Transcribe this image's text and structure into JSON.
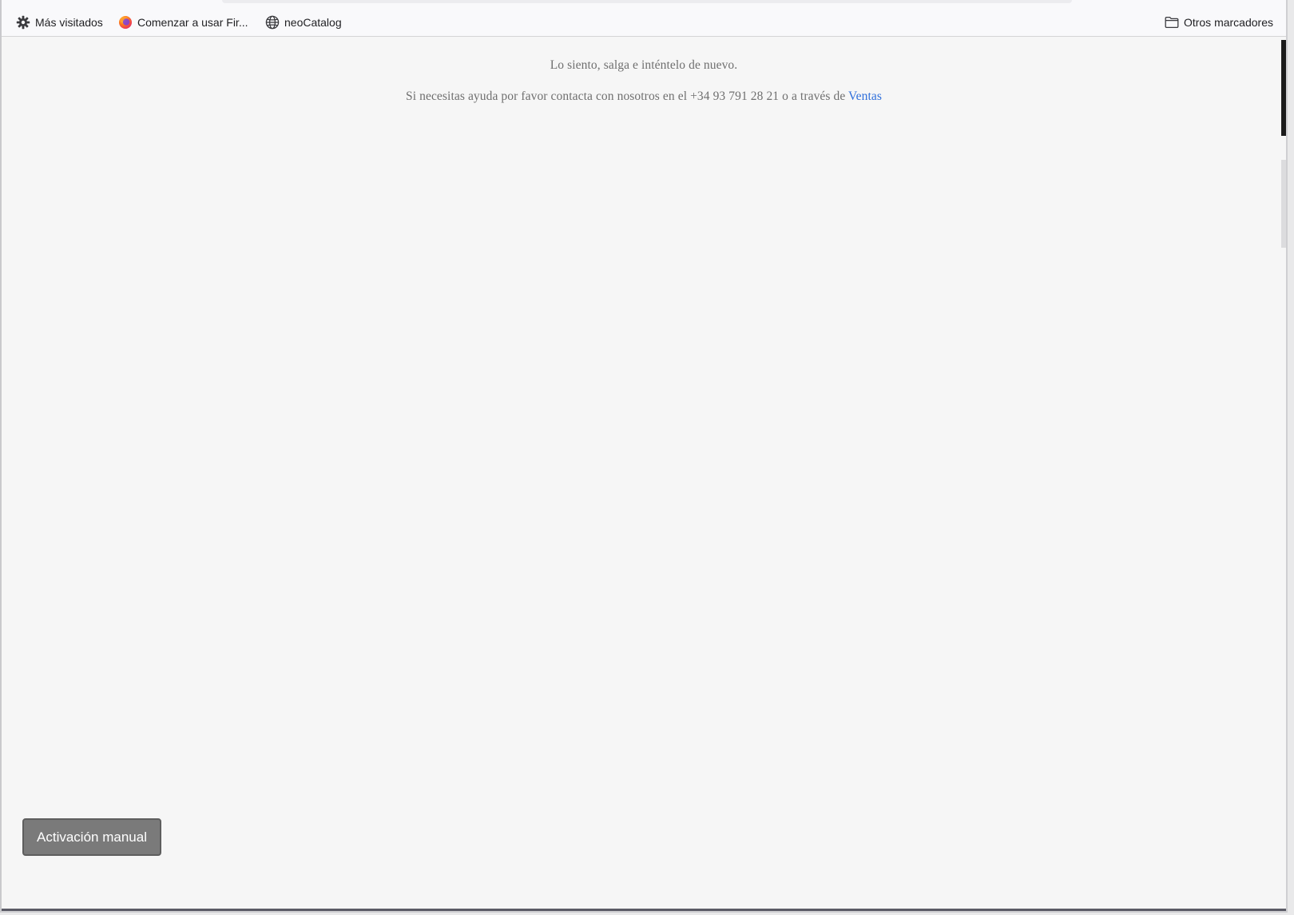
{
  "bookmarks": {
    "items": [
      {
        "label": "Más visitados",
        "icon": "gear-icon"
      },
      {
        "label": "Comenzar a usar Fir...",
        "icon": "firefox-icon"
      },
      {
        "label": "neoCatalog",
        "icon": "globe-icon"
      }
    ],
    "other": {
      "label": "Otros marcadores",
      "icon": "folder-icon"
    }
  },
  "content": {
    "line1": "Lo siento, salga e inténtelo de nuevo.",
    "line2": "Si necesitas ayuda por favor contacta con nosotros en el +34 93 791 28 21 o a través de",
    "link": "Ventas"
  },
  "manual_button": {
    "label": "Activación manual"
  },
  "colors": {
    "link": "#2f6fdb",
    "button_bg": "#7a7a7a",
    "page_bg": "#f6f6f6",
    "text": "#6f6f6f"
  }
}
